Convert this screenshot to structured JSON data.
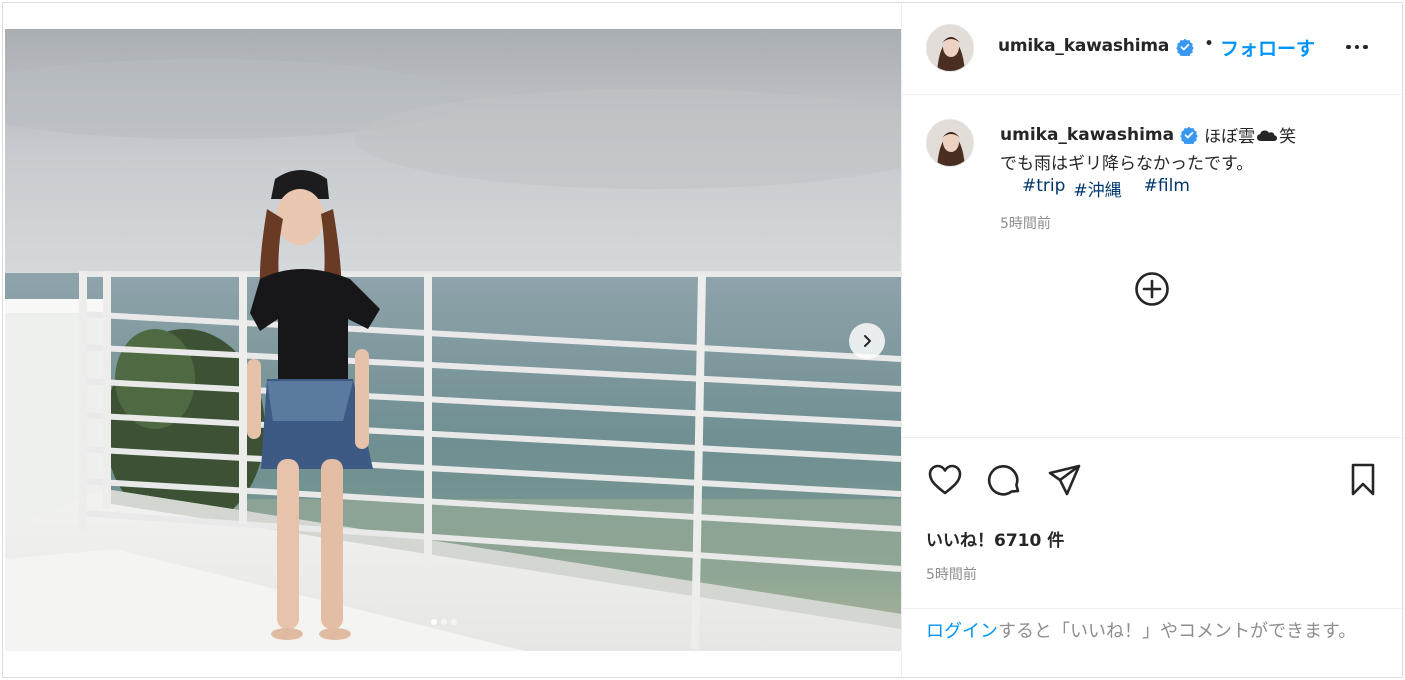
{
  "post": {
    "carousel": {
      "slide_count": 3,
      "active_index": 0
    },
    "user": {
      "username": "umika_kawashima",
      "verified": true,
      "follow_label": "フォローす",
      "separator": "•"
    },
    "caption": {
      "text_prefix": "ほぼ雲",
      "emoji": "cloud",
      "text_suffix": "笑",
      "line2": "でも雨はギリ降らなかったです。",
      "hashtags": [
        "#trip",
        "#沖縄",
        "#film"
      ],
      "time": "5時間前"
    },
    "actions": {
      "likes": "いいね！6710 件",
      "time": "5時間前"
    },
    "login": {
      "link": "ログイン",
      "text": "すると「いいね！」やコメントができます。"
    }
  },
  "icons": {
    "like": "heart-icon",
    "comment": "comment-icon",
    "share": "share-icon",
    "save": "bookmark-icon",
    "more": "more-icon",
    "add": "plus-circle-icon",
    "next": "chevron-right-icon",
    "verified": "verified-badge-icon"
  },
  "colors": {
    "accent": "#0095f6",
    "verified": "#3897f0",
    "text": "#262626",
    "muted": "#8e8e8e",
    "hashtag": "#00376b"
  }
}
